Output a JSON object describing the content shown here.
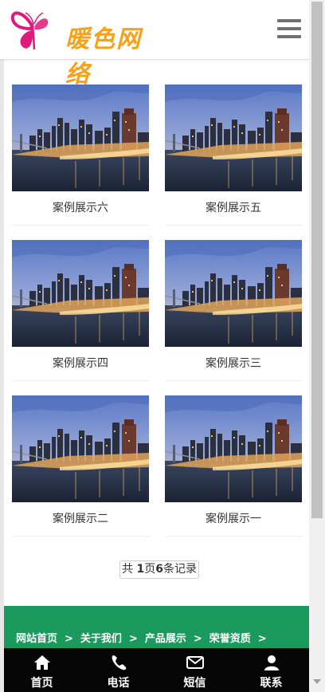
{
  "header": {
    "logo_text": "暖色网络",
    "menu_icon": "hamburger-menu-icon"
  },
  "cases": [
    {
      "title": "案例展示六"
    },
    {
      "title": "案例展示五"
    },
    {
      "title": "案例展示四"
    },
    {
      "title": "案例展示三"
    },
    {
      "title": "案例展示二"
    },
    {
      "title": "案例展示一"
    }
  ],
  "pager": {
    "prefix": "共 ",
    "pages": "1",
    "mid": "页",
    "records": "6",
    "suffix": "条记录"
  },
  "footer": {
    "links": [
      "网站首页",
      "关于我们",
      "产品展示",
      "荣誉资质"
    ],
    "separator": ">"
  },
  "bottom_nav": [
    {
      "label": "首页",
      "icon": "home-icon"
    },
    {
      "label": "电话",
      "icon": "phone-icon"
    },
    {
      "label": "短信",
      "icon": "envelope-icon"
    },
    {
      "label": "联系",
      "icon": "user-icon"
    }
  ],
  "colors": {
    "logo_text": "#f5a21a",
    "logo_butterfly": "#e0197a",
    "footer_green": "#1b9a5d",
    "bottom_nav_bg": "#050505"
  }
}
